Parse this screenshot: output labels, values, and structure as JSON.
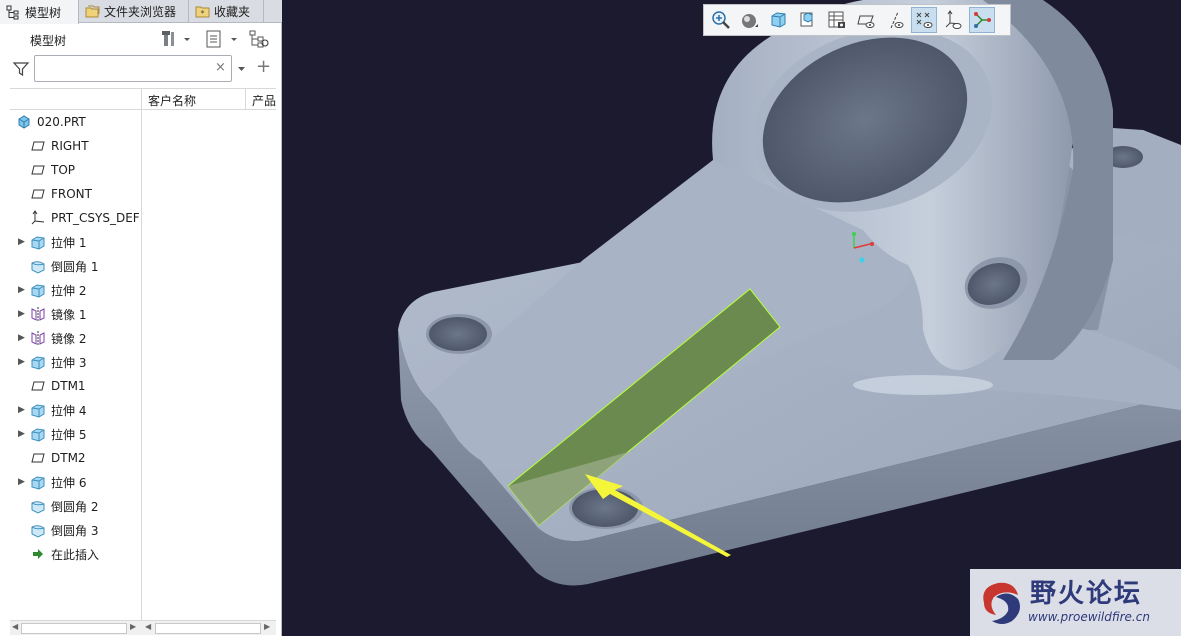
{
  "tabs": [
    {
      "label": "模型树",
      "icon": "model-tree-icon",
      "active": true
    },
    {
      "label": "文件夹浏览器",
      "icon": "folder-browser-icon",
      "active": false
    },
    {
      "label": "收藏夹",
      "icon": "favorites-icon",
      "active": false
    }
  ],
  "panel": {
    "title": "模型树",
    "buttons": [
      "settings-tools-icon",
      "show-list-icon",
      "tree-filter-icon"
    ]
  },
  "filter": {
    "value": "",
    "placeholder": "",
    "clear": "×",
    "add": "+"
  },
  "columns": [
    "客户名称",
    "产品"
  ],
  "tree": [
    {
      "label": "020.PRT",
      "icon": "part-icon",
      "expander": false,
      "indent": 0
    },
    {
      "label": "RIGHT",
      "icon": "datum-plane-icon",
      "expander": false,
      "indent": 1
    },
    {
      "label": "TOP",
      "icon": "datum-plane-icon",
      "expander": false,
      "indent": 1
    },
    {
      "label": "FRONT",
      "icon": "datum-plane-icon",
      "expander": false,
      "indent": 1
    },
    {
      "label": "PRT_CSYS_DEF",
      "icon": "coordinate-system-icon",
      "expander": false,
      "indent": 1
    },
    {
      "label": "拉伸 1",
      "icon": "extrude-icon",
      "expander": true,
      "indent": 1
    },
    {
      "label": "倒圆角 1",
      "icon": "round-icon",
      "expander": false,
      "indent": 1
    },
    {
      "label": "拉伸 2",
      "icon": "extrude-icon",
      "expander": true,
      "indent": 1
    },
    {
      "label": "镜像 1",
      "icon": "mirror-icon",
      "expander": true,
      "indent": 1
    },
    {
      "label": "镜像 2",
      "icon": "mirror-icon",
      "expander": true,
      "indent": 1
    },
    {
      "label": "拉伸 3",
      "icon": "extrude-icon",
      "expander": true,
      "indent": 1
    },
    {
      "label": "DTM1",
      "icon": "datum-plane-icon",
      "expander": false,
      "indent": 1
    },
    {
      "label": "拉伸 4",
      "icon": "extrude-icon",
      "expander": true,
      "indent": 1
    },
    {
      "label": "拉伸 5",
      "icon": "extrude-icon",
      "expander": true,
      "indent": 1
    },
    {
      "label": "DTM2",
      "icon": "datum-plane-icon",
      "expander": false,
      "indent": 1
    },
    {
      "label": "拉伸 6",
      "icon": "extrude-icon",
      "expander": true,
      "indent": 1
    },
    {
      "label": "倒圆角 2",
      "icon": "round-icon",
      "expander": false,
      "indent": 1
    },
    {
      "label": "倒圆角 3",
      "icon": "round-icon",
      "expander": false,
      "indent": 1
    },
    {
      "label": "在此插入",
      "icon": "insert-here-icon",
      "expander": false,
      "indent": 1
    }
  ],
  "view_toolbar": [
    {
      "icon": "zoom-in-icon",
      "active": false
    },
    {
      "icon": "display-style-icon",
      "active": false
    },
    {
      "icon": "saved-orientation-icon",
      "active": false
    },
    {
      "icon": "view-manager-icon",
      "active": false
    },
    {
      "icon": "appearance-gallery-icon",
      "active": false
    },
    {
      "icon": "plane-display-icon",
      "active": false
    },
    {
      "icon": "axis-display-icon",
      "active": false
    },
    {
      "icon": "point-display-icon",
      "active": true
    },
    {
      "icon": "csys-display-icon",
      "active": false
    },
    {
      "icon": "annotation-display-icon",
      "active": true
    }
  ],
  "watermark": {
    "title": "野火论坛",
    "url": "www.proewildfire.cn"
  },
  "colors": {
    "background": "#1b1a2e",
    "part": "#a9b4c6",
    "highlight": "#6b8a4f",
    "edge_highlight": "#b8ff3a",
    "arrow": "#f5f53a"
  }
}
